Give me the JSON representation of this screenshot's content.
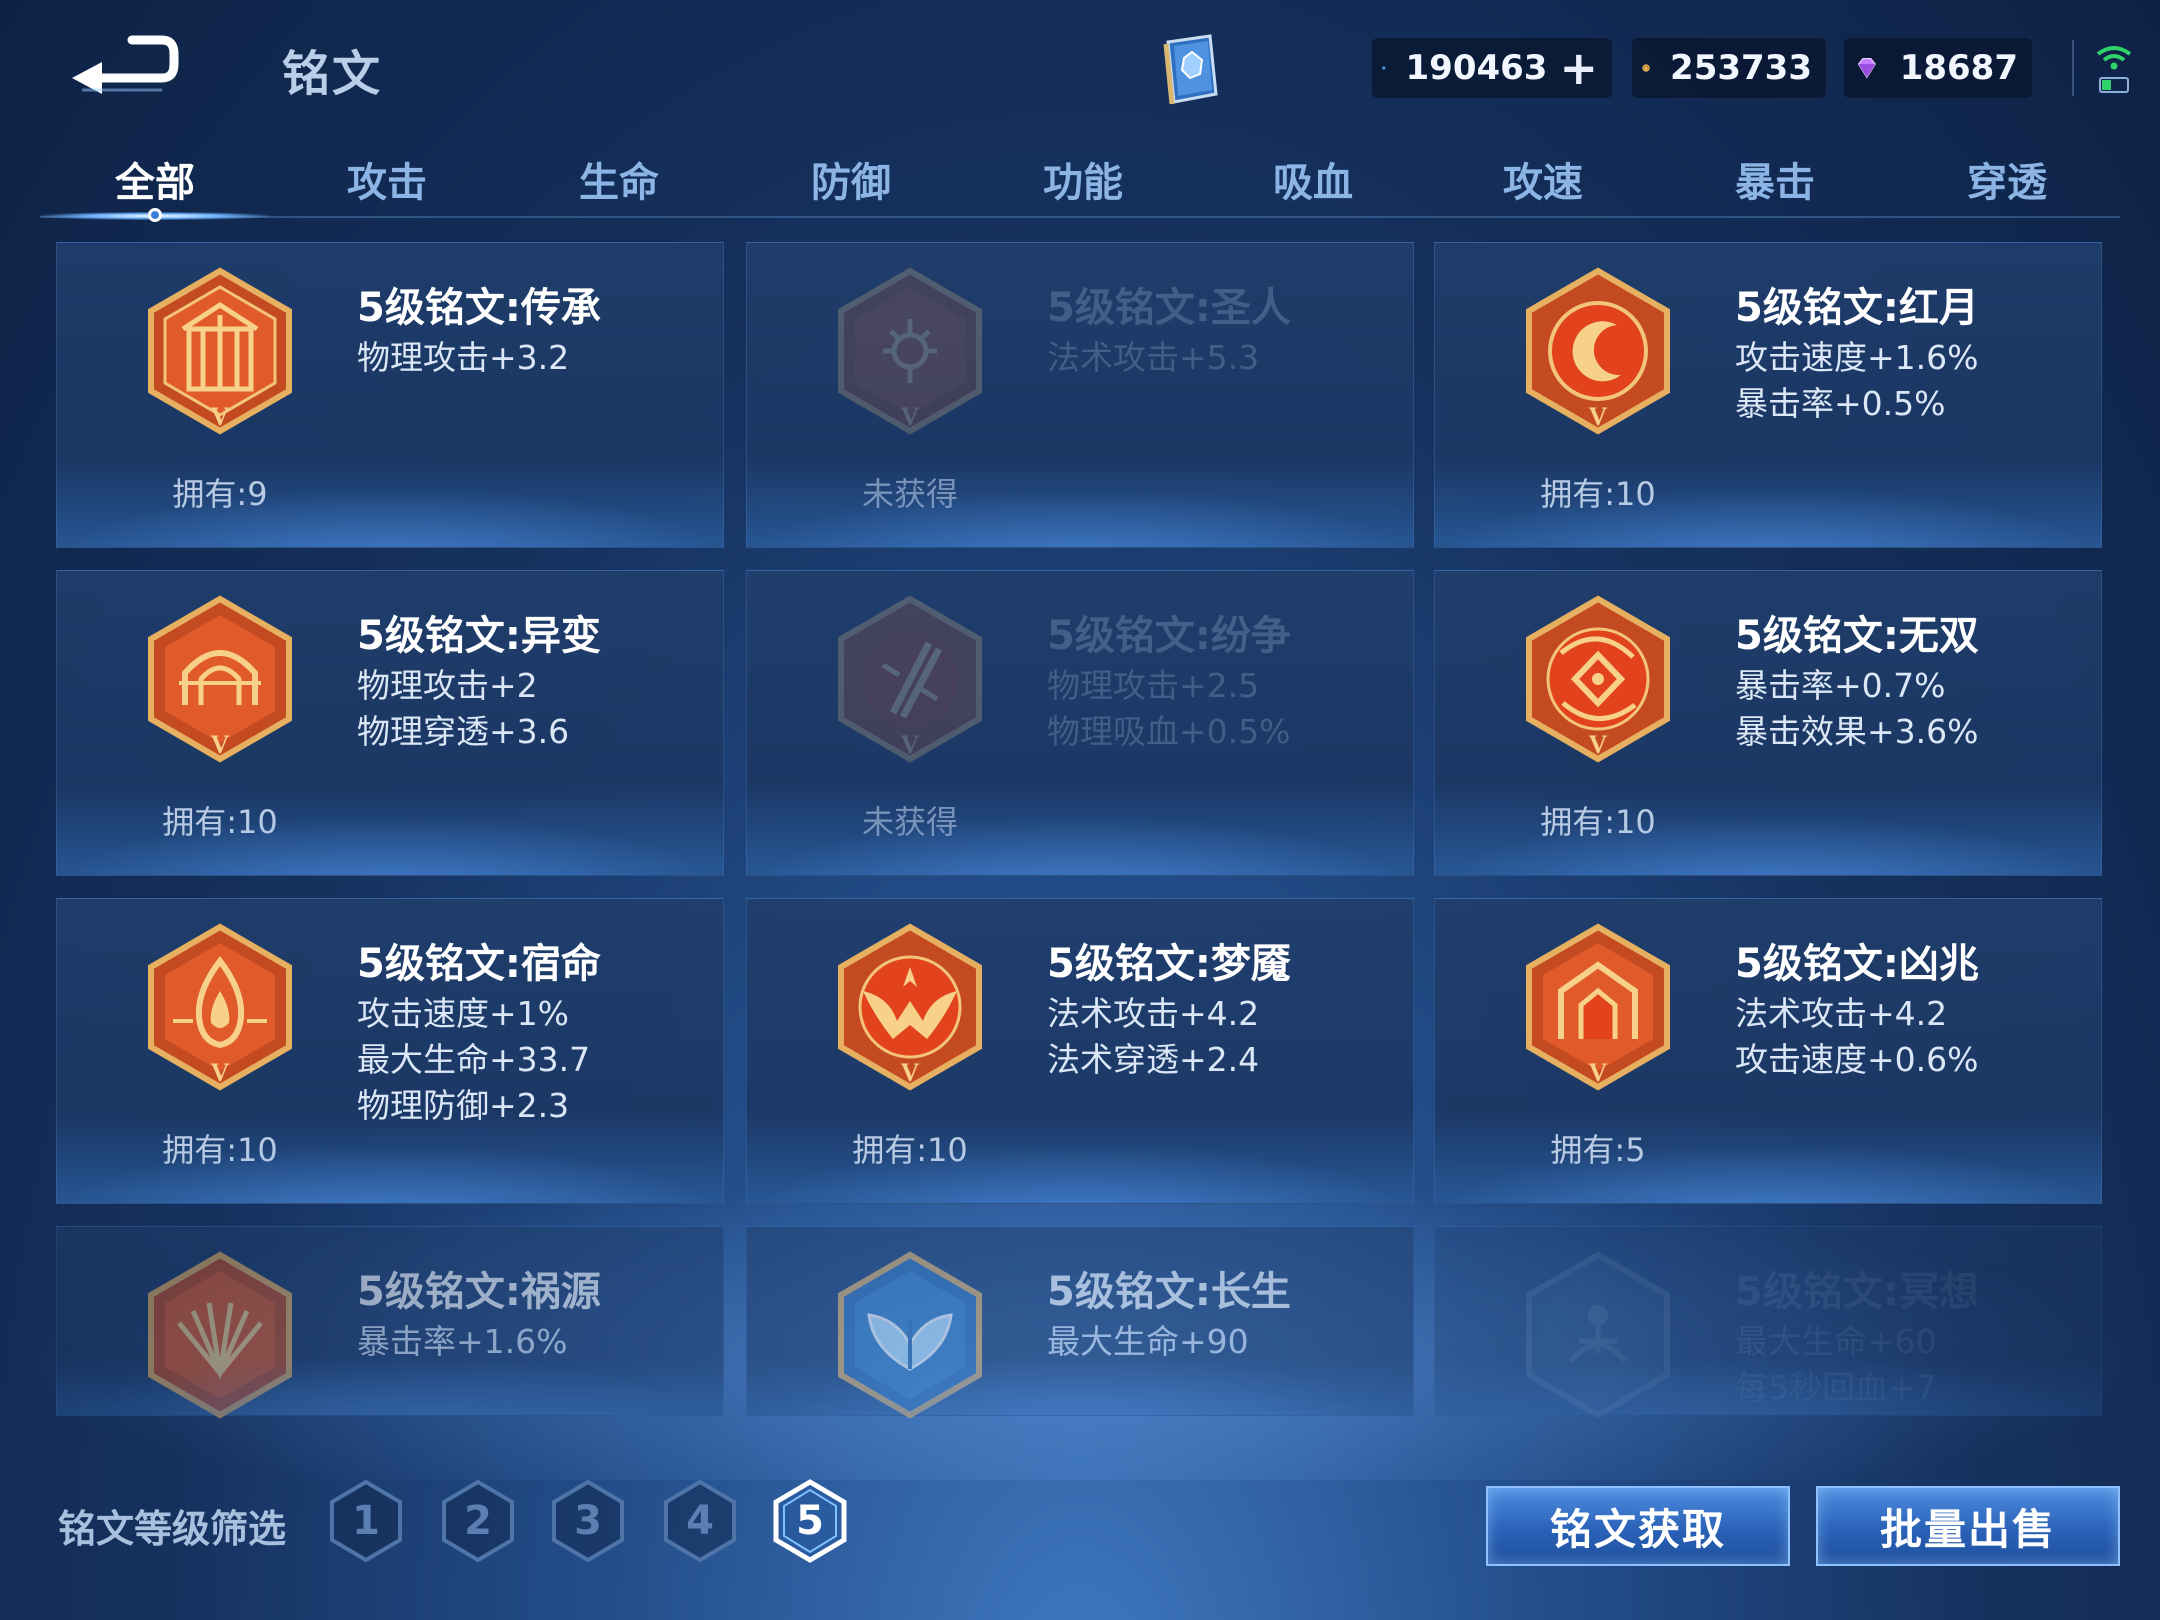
{
  "header": {
    "title": "铭文",
    "currencies": {
      "gem": "190463",
      "coin": "253733",
      "diamond": "18687"
    },
    "plus": "+"
  },
  "tabs": [
    {
      "label": "全部",
      "active": true
    },
    {
      "label": "攻击"
    },
    {
      "label": "生命"
    },
    {
      "label": "防御"
    },
    {
      "label": "功能"
    },
    {
      "label": "吸血"
    },
    {
      "label": "攻速"
    },
    {
      "label": "暴击"
    },
    {
      "label": "穿透"
    }
  ],
  "runes": [
    {
      "name": "5级铭文:传承",
      "stats": [
        "物理攻击+3.2"
      ],
      "owned": "拥有:9",
      "icon": "pillar-icon",
      "locked": false
    },
    {
      "name": "5级铭文:圣人",
      "stats": [
        "法术攻击+5.3"
      ],
      "owned": "未获得",
      "icon": "flower-icon",
      "locked": true
    },
    {
      "name": "5级铭文:红月",
      "stats": [
        "攻击速度+1.6%",
        "暴击率+0.5%"
      ],
      "owned": "拥有:10",
      "icon": "crescent-moon-icon",
      "locked": false
    },
    {
      "name": "5级铭文:异变",
      "stats": [
        "物理攻击+2",
        "物理穿透+3.6"
      ],
      "owned": "拥有:10",
      "icon": "arch-icon",
      "locked": false
    },
    {
      "name": "5级铭文:纷争",
      "stats": [
        "物理攻击+2.5",
        "物理吸血+0.5%"
      ],
      "owned": "未获得",
      "icon": "blade-icon",
      "locked": true
    },
    {
      "name": "5级铭文:无双",
      "stats": [
        "暴击率+0.7%",
        "暴击效果+3.6%"
      ],
      "owned": "拥有:10",
      "icon": "swirl-diamond-icon",
      "locked": false
    },
    {
      "name": "5级铭文:宿命",
      "stats": [
        "攻击速度+1%",
        "最大生命+33.7",
        "物理防御+2.3"
      ],
      "owned": "拥有:10",
      "icon": "flame-icon",
      "locked": false
    },
    {
      "name": "5级铭文:梦魇",
      "stats": [
        "法术攻击+4.2",
        "法术穿透+2.4"
      ],
      "owned": "拥有:10",
      "icon": "bat-wing-icon",
      "locked": false
    },
    {
      "name": "5级铭文:凶兆",
      "stats": [
        "法术攻击+4.2",
        "攻击速度+0.6%"
      ],
      "owned": "拥有:5",
      "icon": "gate-icon",
      "locked": false
    },
    {
      "name": "5级铭文:祸源",
      "stats": [
        "暴击率+1.6%"
      ],
      "owned": "",
      "icon": "fan-icon",
      "locked": false
    },
    {
      "name": "5级铭文:长生",
      "stats": [
        "最大生命+90"
      ],
      "owned": "",
      "icon": "leaf-icon",
      "locked": false
    },
    {
      "name": "5级铭文:冥想",
      "stats": [
        "最大生命+60",
        "每5秒回血+7"
      ],
      "owned": "",
      "icon": "meditation-icon",
      "locked": true
    }
  ],
  "filter": {
    "label": "铭文等级筛选",
    "levels": [
      "1",
      "2",
      "3",
      "4",
      "5"
    ],
    "active_level": "5"
  },
  "buttons": {
    "acquire": "铭文获取",
    "sell": "批量出售"
  },
  "colors": {
    "background": "#15315e",
    "rune_red": "#d0401c",
    "rune_gold": "#e6b060",
    "rune_blue": "#3a80c6",
    "accent": "#6fb4ff"
  }
}
